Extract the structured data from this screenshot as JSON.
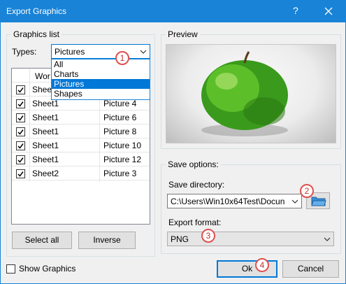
{
  "window": {
    "title": "Export Graphics",
    "help_label": "?"
  },
  "graphics_list": {
    "legend": "Graphics list",
    "types_label": "Types:",
    "types_selected": "Pictures",
    "types_options": [
      "All",
      "Charts",
      "Pictures",
      "Shapes"
    ],
    "column_header": "Wor",
    "rows": [
      {
        "sheet": "Sheet1",
        "picture": "",
        "checked": true
      },
      {
        "sheet": "Sheet1",
        "picture": "Picture 4",
        "checked": true
      },
      {
        "sheet": "Sheet1",
        "picture": "Picture 6",
        "checked": true
      },
      {
        "sheet": "Sheet1",
        "picture": "Picture 8",
        "checked": true
      },
      {
        "sheet": "Sheet1",
        "picture": "Picture 10",
        "checked": true
      },
      {
        "sheet": "Sheet1",
        "picture": "Picture 12",
        "checked": true
      },
      {
        "sheet": "Sheet2",
        "picture": "Picture 3",
        "checked": true
      }
    ],
    "select_all_label": "Select all",
    "inverse_label": "Inverse"
  },
  "preview": {
    "legend": "Preview"
  },
  "save_options": {
    "legend": "Save options:",
    "directory_label": "Save directory:",
    "directory_value": "C:\\Users\\Win10x64Test\\Docun",
    "format_label": "Export format:",
    "format_value": "PNG"
  },
  "footer": {
    "show_graphics_label": "Show Graphics",
    "ok_label": "Ok",
    "cancel_label": "Cancel"
  },
  "badges": [
    "1",
    "2",
    "3",
    "4"
  ],
  "colors": {
    "title_bar": "#1883d7",
    "selection": "#0078d7",
    "badge": "#e05050"
  }
}
